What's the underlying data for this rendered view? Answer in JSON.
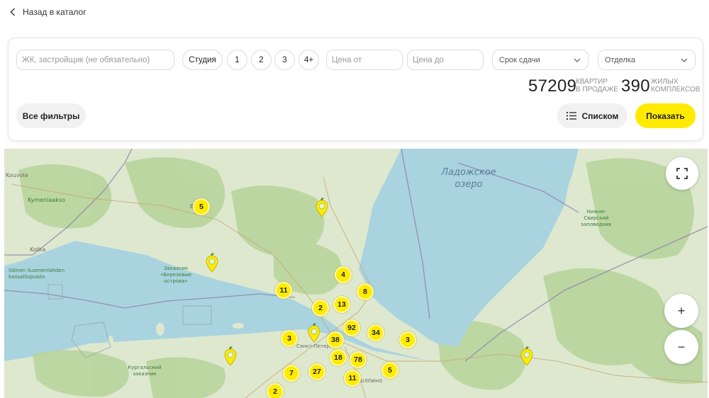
{
  "back": {
    "label": "Назад в каталог",
    "icon": "chevron-left-icon"
  },
  "filters": {
    "search_placeholder": "ЖК, застройщик (не обязательно)",
    "rooms": [
      "Студия",
      "1",
      "2",
      "3",
      "4+"
    ],
    "price_from_placeholder": "Цена от",
    "price_to_placeholder": "Цена до",
    "deadline_label": "Срок сдачи",
    "finish_label": "Отделка",
    "all_filters_label": "Все фильтры",
    "list_label": "Списком",
    "show_label": "Показать"
  },
  "stats": {
    "apartments_count": "57209",
    "apartments_label_1": "КВАРТИР",
    "apartments_label_2": "В ПРОДАЖЕ",
    "complexes_count": "390",
    "complexes_label_1": "ЖИЛЫХ",
    "complexes_label_2": "КОМПЛЕКСОВ"
  },
  "map": {
    "labels": {
      "lake": "Ладожское озеро",
      "kouvola": "Kouvola",
      "kymenlaakso": "Kymenlaakso",
      "kotka": "Kotka",
      "itainen": "Itäinen Suomenlahden kansallispuisto",
      "berezovye": "Заказник «Березовые острова»",
      "svirsky": "Нижне-Свирский заповедник",
      "kurgalsky": "Кургальский заказник",
      "spb": "Санкт-Петербург",
      "kolpino": "Колпино",
      "v": "В"
    },
    "clusters": [
      "5",
      "4",
      "11",
      "8",
      "2",
      "13",
      "92",
      "34",
      "3",
      "38",
      "3",
      "18",
      "78",
      "5",
      "7",
      "27",
      "11",
      "2"
    ],
    "zoom_in": "+",
    "zoom_out": "−"
  },
  "colors": {
    "accent": "#FFEA00",
    "water": "#A9D3DF",
    "land": "#DDE8CF",
    "forest": "#B7D39A"
  }
}
